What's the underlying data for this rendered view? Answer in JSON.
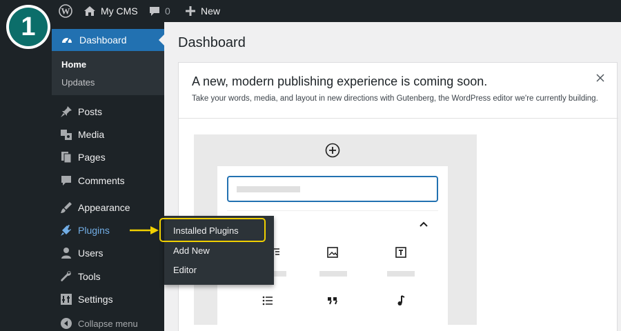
{
  "step_badge": {
    "number": "1"
  },
  "adminbar": {
    "site_name": "My CMS",
    "comment_count": "0",
    "new_label": "New",
    "icons": {
      "wp": "wordpress-logo-icon",
      "home": "home-icon",
      "comments": "comment-bubble-icon",
      "new": "plus-icon"
    }
  },
  "sidebar": {
    "dashboard": {
      "label": "Dashboard",
      "icon": "dashboard-gauge-icon"
    },
    "submenu": [
      {
        "label": "Home",
        "current": true
      },
      {
        "label": "Updates",
        "current": false
      }
    ],
    "items": [
      {
        "label": "Posts",
        "icon": "pushpin-icon"
      },
      {
        "label": "Media",
        "icon": "media-icon"
      },
      {
        "label": "Pages",
        "icon": "pages-icon"
      },
      {
        "label": "Comments",
        "icon": "comment-icon"
      },
      {
        "label": "Appearance",
        "icon": "paintbrush-icon"
      },
      {
        "label": "Plugins",
        "icon": "plugin-icon",
        "active": true
      },
      {
        "label": "Users",
        "icon": "users-icon"
      },
      {
        "label": "Tools",
        "icon": "wrench-icon"
      },
      {
        "label": "Settings",
        "icon": "settings-sliders-icon"
      }
    ],
    "collapse_label": "Collapse menu"
  },
  "plugins_flyout": {
    "items": [
      {
        "label": "Installed Plugins",
        "highlighted": true
      },
      {
        "label": "Add New"
      },
      {
        "label": "Editor"
      }
    ]
  },
  "main": {
    "page_title": "Dashboard",
    "notice": {
      "heading": "A new, modern publishing experience is coming soon.",
      "body": "Take your words, media, and layout in new directions with Gutenberg, the WordPress editor we're currently building."
    }
  },
  "colors": {
    "adminbar_bg": "#1d2327",
    "menu_active_bg": "#2271b1",
    "active_link": "#72aee6",
    "highlight": "#f0d000",
    "badge": "#0c6e6a"
  }
}
